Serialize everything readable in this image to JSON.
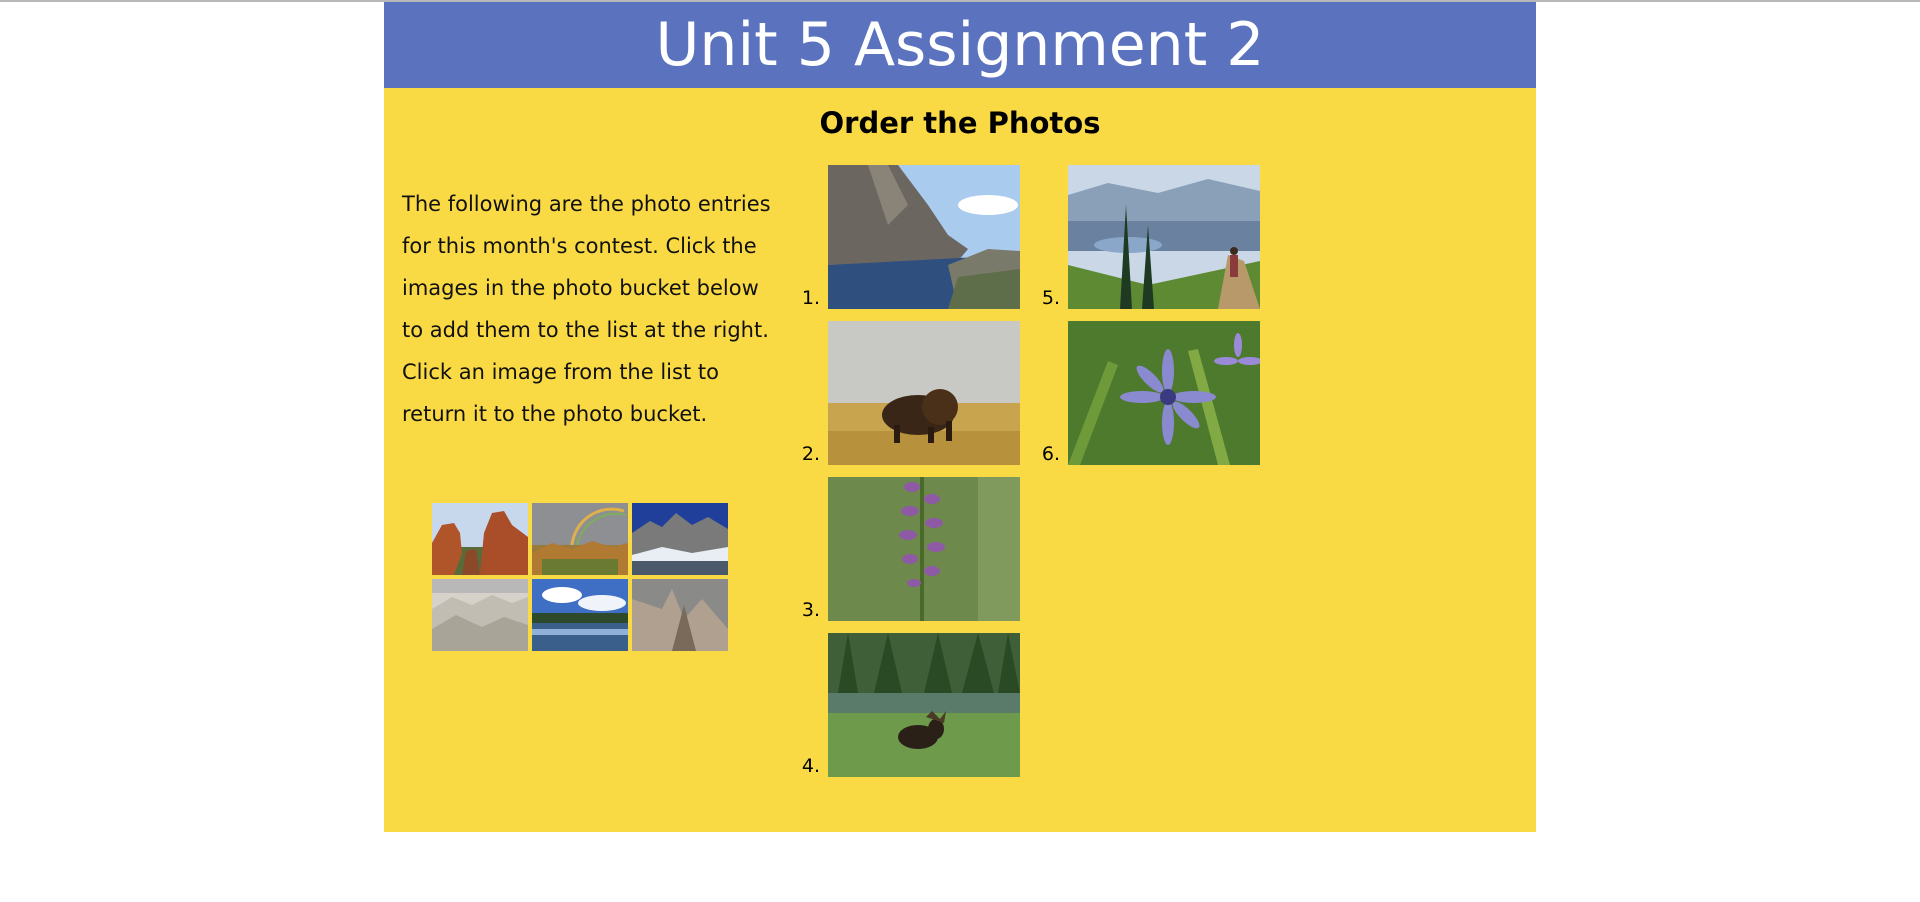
{
  "header": {
    "title": "Unit 5 Assignment 2"
  },
  "main": {
    "heading": "Order the Photos",
    "intro": "The following are the photo entries for this month's contest. Click the images in the photo bucket below to add them to the list at the right. Click an image from the list to return it to the photo bucket."
  },
  "ordered_list": [
    {
      "number": "1.",
      "icon": "lake-cliff-photo"
    },
    {
      "number": "2.",
      "icon": "bison-photo"
    },
    {
      "number": "3.",
      "icon": "purple-orchid-photo"
    },
    {
      "number": "4.",
      "icon": "moose-photo"
    },
    {
      "number": "5.",
      "icon": "mountain-trail-photo"
    },
    {
      "number": "6.",
      "icon": "blue-flower-photo"
    }
  ],
  "photo_bucket": [
    {
      "icon": "red-rocks-photo"
    },
    {
      "icon": "rainbow-canyon-photo"
    },
    {
      "icon": "snowy-peaks-photo"
    },
    {
      "icon": "badlands-photo"
    },
    {
      "icon": "mountain-lake-photo"
    },
    {
      "icon": "rock-spire-photo"
    }
  ],
  "colors": {
    "header_bg": "#5b73be",
    "page_bg": "#f9da45"
  }
}
